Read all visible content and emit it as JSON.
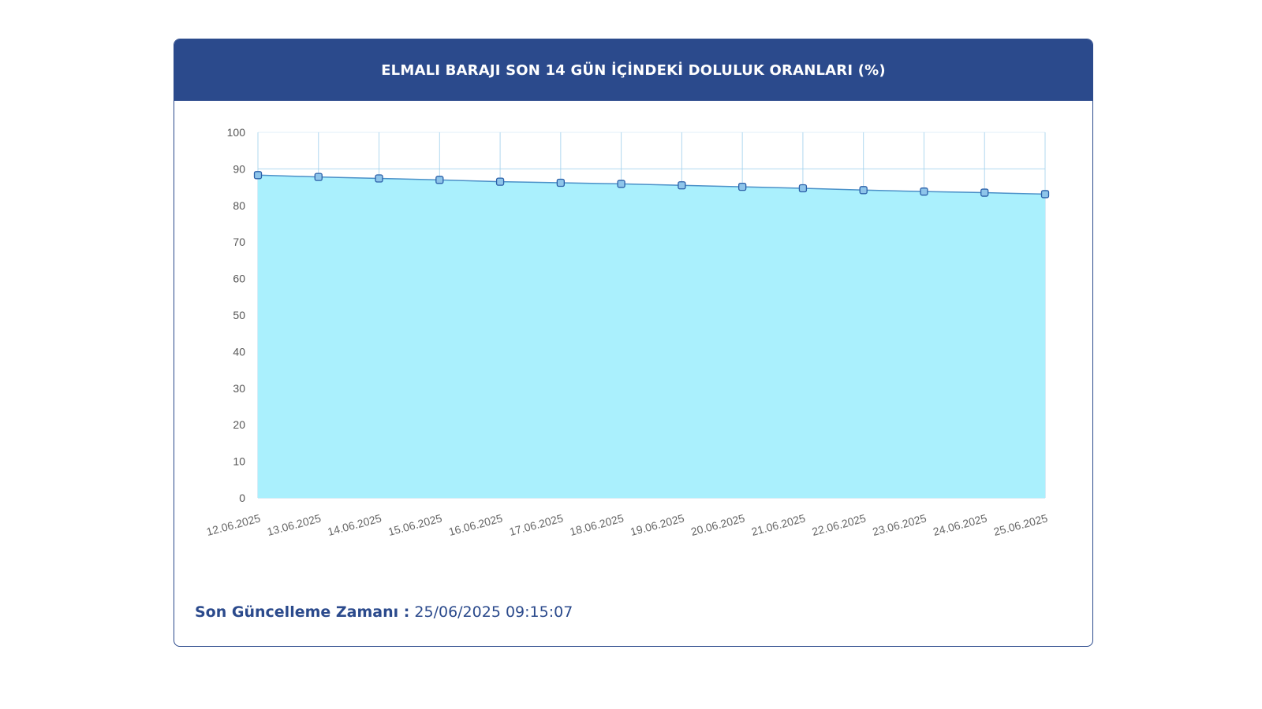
{
  "card": {
    "title": "ELMALI BARAJI SON 14 GÜN İÇİNDEKİ DOLULUK ORANLARI (%)"
  },
  "footer": {
    "label": "Son Güncelleme Zamanı :",
    "value": " 25/06/2025 09:15:07"
  },
  "colors": {
    "header": "#2b4a8c",
    "area_fill": "#aaf0fd",
    "line": "#4a90c8",
    "grid": "#a8d4ee",
    "marker_fill": "#8ec5ea",
    "marker_stroke": "#2a5fa8"
  },
  "chart_data": {
    "type": "area",
    "title": "ELMALI BARAJI SON 14 GÜN İÇİNDEKİ DOLULUK ORANLARI (%)",
    "xlabel": "",
    "ylabel": "",
    "ylim": [
      0,
      100
    ],
    "yticks": [
      0,
      10,
      20,
      30,
      40,
      50,
      60,
      70,
      80,
      90,
      100
    ],
    "grid": true,
    "categories": [
      "12.06.2025",
      "13.06.2025",
      "14.06.2025",
      "15.06.2025",
      "16.06.2025",
      "17.06.2025",
      "18.06.2025",
      "19.06.2025",
      "20.06.2025",
      "21.06.2025",
      "22.06.2025",
      "23.06.2025",
      "24.06.2025",
      "25.06.2025"
    ],
    "series": [
      {
        "values": [
          88.3,
          87.8,
          87.4,
          87.0,
          86.5,
          86.2,
          85.9,
          85.5,
          85.1,
          84.7,
          84.2,
          83.8,
          83.5,
          83.1
        ]
      }
    ]
  }
}
